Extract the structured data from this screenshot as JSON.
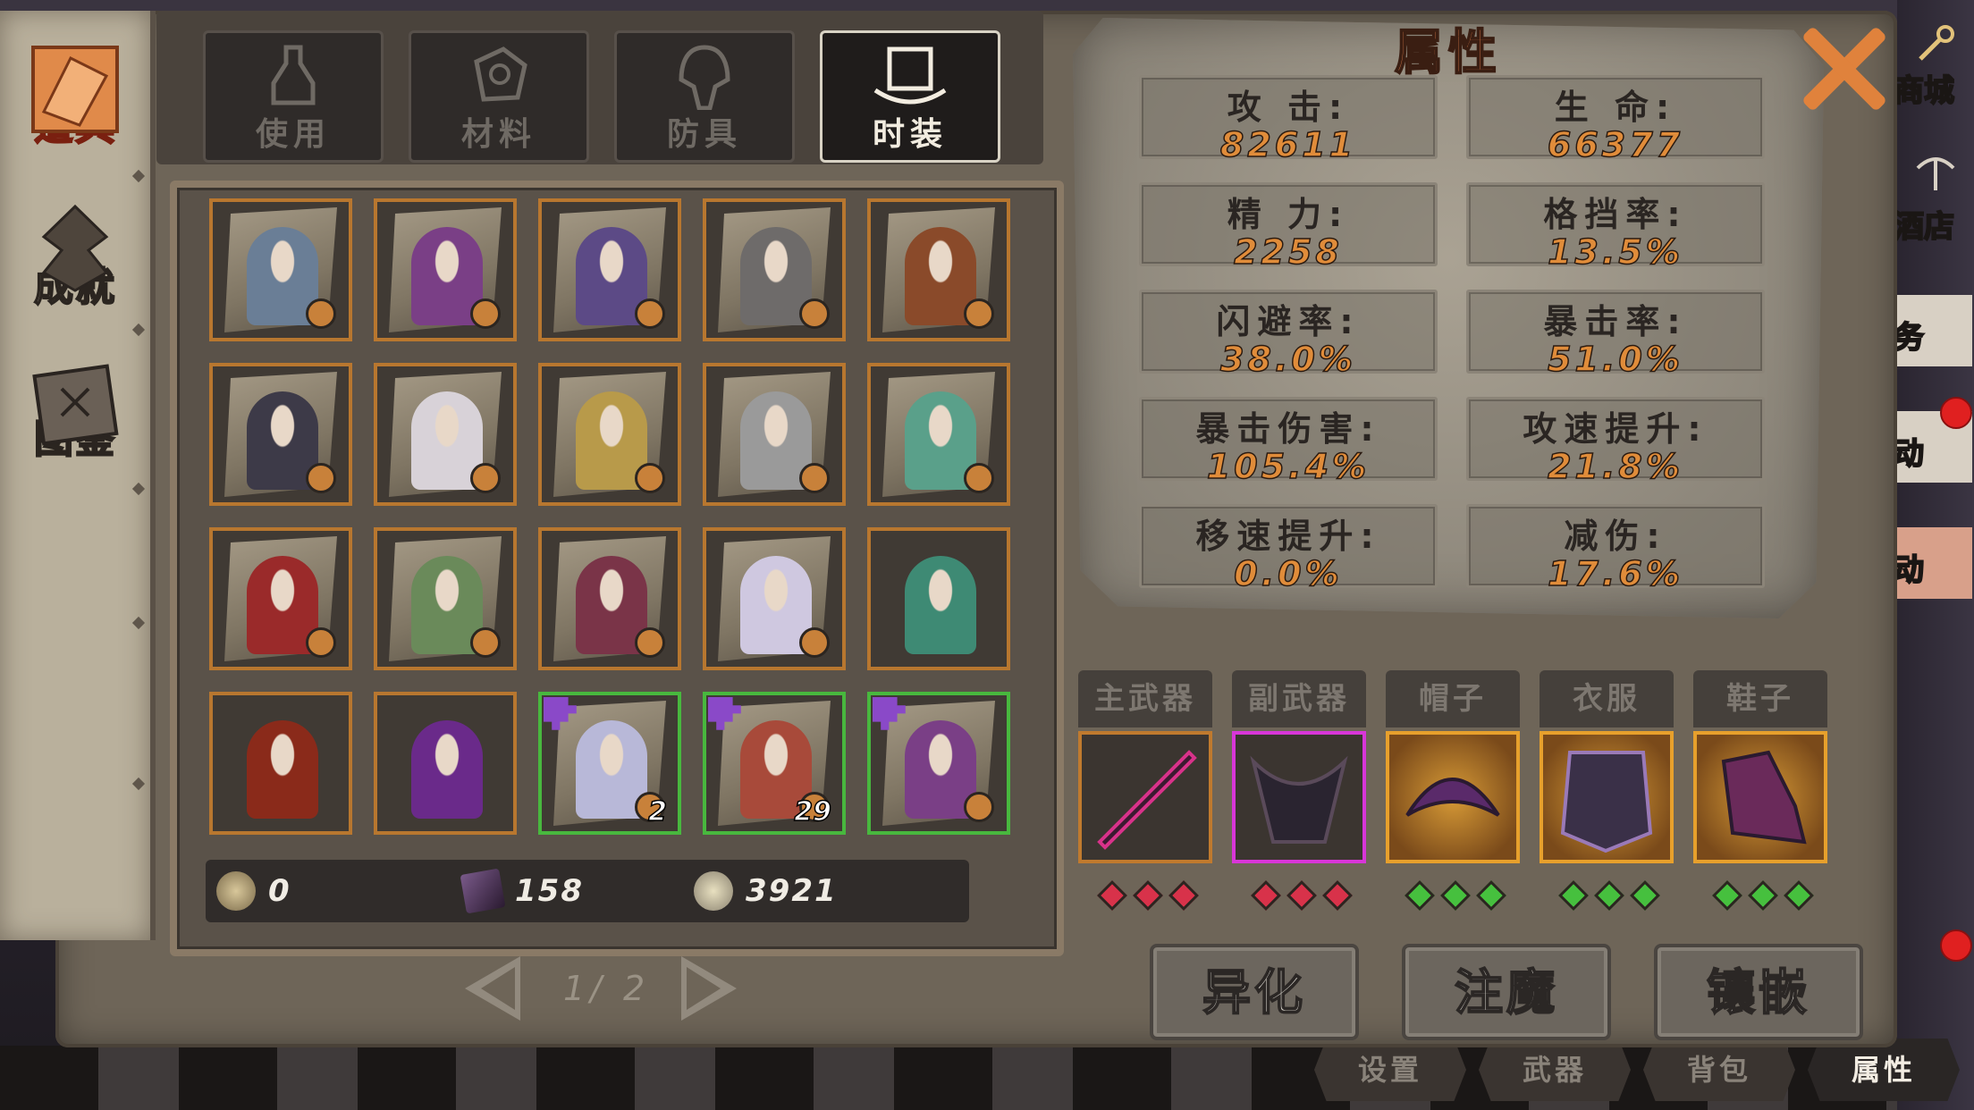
{
  "sidebar": {
    "items": [
      {
        "label": "道具",
        "icon": "item-bag-icon",
        "active": true
      },
      {
        "label": "成就",
        "icon": "achievement-emblem-icon",
        "active": false
      },
      {
        "label": "图鉴",
        "icon": "codex-book-icon",
        "active": false
      }
    ]
  },
  "tabs": [
    {
      "label": "使用",
      "icon": "potion-icon",
      "active": false
    },
    {
      "label": "材料",
      "icon": "material-ore-icon",
      "active": false
    },
    {
      "label": "防具",
      "icon": "helmet-icon",
      "active": false
    },
    {
      "label": "时装",
      "icon": "top-hat-icon",
      "active": true
    }
  ],
  "inventory": {
    "rows": [
      [
        {
          "portrait": "#6a7e96",
          "frame": "orange",
          "scroll": true,
          "count": ""
        },
        {
          "portrait": "#7a3f86",
          "frame": "orange",
          "scroll": true,
          "count": ""
        },
        {
          "portrait": "#5c4a86",
          "frame": "orange",
          "scroll": true,
          "count": ""
        },
        {
          "portrait": "#6e6b6a",
          "frame": "orange",
          "scroll": true,
          "count": ""
        },
        {
          "portrait": "#8a4a2a",
          "frame": "orange",
          "scroll": true,
          "count": ""
        }
      ],
      [
        {
          "portrait": "#3d3a48",
          "frame": "orange",
          "scroll": true,
          "count": ""
        },
        {
          "portrait": "#d8d2d8",
          "frame": "orange",
          "scroll": true,
          "count": ""
        },
        {
          "portrait": "#b89a4a",
          "frame": "orange",
          "scroll": true,
          "count": ""
        },
        {
          "portrait": "#9a9a9a",
          "frame": "orange",
          "scroll": true,
          "count": ""
        },
        {
          "portrait": "#5aa08a",
          "frame": "orange",
          "scroll": true,
          "count": ""
        }
      ],
      [
        {
          "portrait": "#9a2a2a",
          "frame": "orange",
          "scroll": true,
          "count": ""
        },
        {
          "portrait": "#6a8a5a",
          "frame": "orange",
          "scroll": true,
          "count": ""
        },
        {
          "portrait": "#7a3448",
          "frame": "orange",
          "scroll": true,
          "count": ""
        },
        {
          "portrait": "#cfc8e0",
          "frame": "orange",
          "scroll": true,
          "count": ""
        },
        {
          "portrait": "#3e8a74",
          "frame": "orange",
          "scroll": false,
          "count": ""
        }
      ],
      [
        {
          "portrait": "#8a2a1a",
          "frame": "orange",
          "scroll": false,
          "count": ""
        },
        {
          "portrait": "#6a2a8a",
          "frame": "orange",
          "scroll": false,
          "count": ""
        },
        {
          "portrait": "#b8b8d8",
          "frame": "green",
          "scroll": true,
          "count": "2",
          "puzzle": true
        },
        {
          "portrait": "#a84a3a",
          "frame": "green",
          "scroll": true,
          "count": "29",
          "puzzle": true
        },
        {
          "portrait": "#7a3f86",
          "frame": "green",
          "scroll": true,
          "count": "",
          "puzzle": true
        }
      ]
    ]
  },
  "currency": [
    {
      "icon": "coin-icon",
      "value": "0",
      "color": "#b9a37a"
    },
    {
      "icon": "spellbook-icon",
      "value": "158",
      "color": "#6a4a7a"
    },
    {
      "icon": "soul-shard-icon",
      "value": "3921",
      "color": "#c8c0a0"
    }
  ],
  "pager": {
    "text": "1/ 2"
  },
  "attributes": {
    "title": "属性",
    "stats": [
      {
        "label": "攻 击:",
        "value": "82611"
      },
      {
        "label": "生 命:",
        "value": "66377"
      },
      {
        "label": "精 力:",
        "value": "2258"
      },
      {
        "label": "格挡率:",
        "value": "13.5%"
      },
      {
        "label": "闪避率:",
        "value": "38.0%"
      },
      {
        "label": "暴击率:",
        "value": "51.0%"
      },
      {
        "label": "暴击伤害:",
        "value": "105.4%"
      },
      {
        "label": "攻速提升:",
        "value": "21.8%"
      },
      {
        "label": "移速提升:",
        "value": "0.0%"
      },
      {
        "label": "减伤:",
        "value": "17.6%"
      }
    ]
  },
  "equipment": [
    {
      "label": "主武器",
      "frame": "orange",
      "gem_color": "#d8324a",
      "item": "sword-icon"
    },
    {
      "label": "副武器",
      "frame": "purple",
      "gem_color": "#d8324a",
      "item": "dark-wings-icon"
    },
    {
      "label": "帽子",
      "frame": "gold",
      "gem_color": "#46c03e",
      "item": "horned-hat-icon"
    },
    {
      "label": "衣服",
      "frame": "gold",
      "gem_color": "#46c03e",
      "item": "dark-armor-icon"
    },
    {
      "label": "鞋子",
      "frame": "gold",
      "gem_color": "#46c03e",
      "item": "boots-icon"
    }
  ],
  "actions": [
    {
      "label": "异化"
    },
    {
      "label": "注魔"
    },
    {
      "label": "镶嵌"
    }
  ],
  "right_strip": [
    {
      "label": "商城",
      "icon": "shop-key-icon"
    },
    {
      "label": "酒店",
      "icon": "tavern-icon"
    },
    {
      "label": "务",
      "icon": "quest-icon"
    },
    {
      "label": "动",
      "icon": "event-icon"
    },
    {
      "label": "动",
      "icon": "event2-icon"
    }
  ],
  "bottom_tabs": [
    {
      "label": "设置",
      "active": false
    },
    {
      "label": "武器",
      "active": false
    },
    {
      "label": "背包",
      "active": false
    },
    {
      "label": "属性",
      "active": true
    }
  ]
}
